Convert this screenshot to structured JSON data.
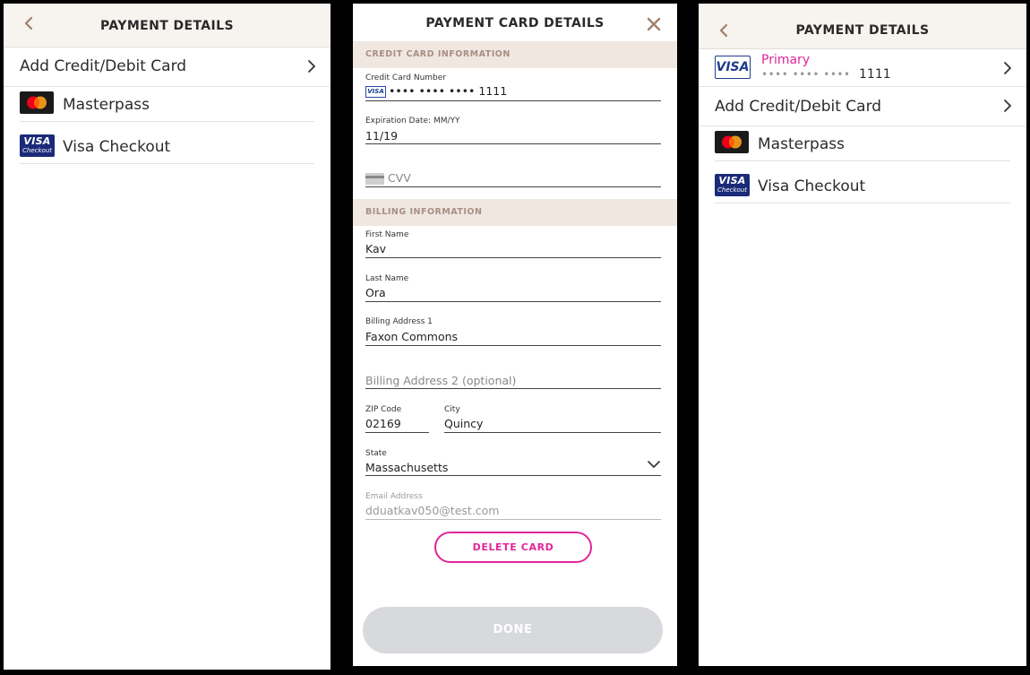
{
  "screen1": {
    "title": "PAYMENT DETAILS",
    "add_card_label": "Add Credit/Debit Card",
    "masterpass_label": "Masterpass",
    "visa_checkout_label": "Visa Checkout"
  },
  "screen2": {
    "title": "PAYMENT CARD DETAILS",
    "credit_section": "CREDIT CARD INFORMATION",
    "card_number_label": "Credit Card Number",
    "card_number_value": "•••• •••• •••• 1111",
    "expiration_label": "Expiration Date: MM/YY",
    "expiration_value": "11/19",
    "cvv_placeholder": "CVV",
    "billing_section": "BILLING INFORMATION",
    "first_name_label": "First Name",
    "first_name_value": "Kav",
    "last_name_label": "Last Name",
    "last_name_value": "Ora",
    "address1_label": "Billing Address 1",
    "address1_value": "Faxon Commons",
    "address2_placeholder": "Billing Address 2 (optional)",
    "zip_label": "ZIP Code",
    "zip_value": "02169",
    "city_label": "City",
    "city_value": "Quincy",
    "state_label": "State",
    "state_value": "Massachusetts",
    "email_label": "Email Address",
    "email_value": "dduatkav050@test.com",
    "delete_label": "DELETE CARD",
    "done_label": "DONE"
  },
  "screen3": {
    "title": "PAYMENT DETAILS",
    "primary_label": "Primary",
    "card_dots": "•••• •••• ••••",
    "card_last4": "1111",
    "add_card_label": "Add Credit/Debit Card",
    "masterpass_label": "Masterpass",
    "visa_checkout_label": "Visa Checkout"
  },
  "logos": {
    "visa": "VISA",
    "checkout": "Checkout"
  },
  "colors": {
    "accent_pink": "#e0259a",
    "back_brown": "#a0806a",
    "header_bg": "#f7f3ef",
    "section_bg": "#efe7e0",
    "done_disabled": "#d8d9dd"
  }
}
